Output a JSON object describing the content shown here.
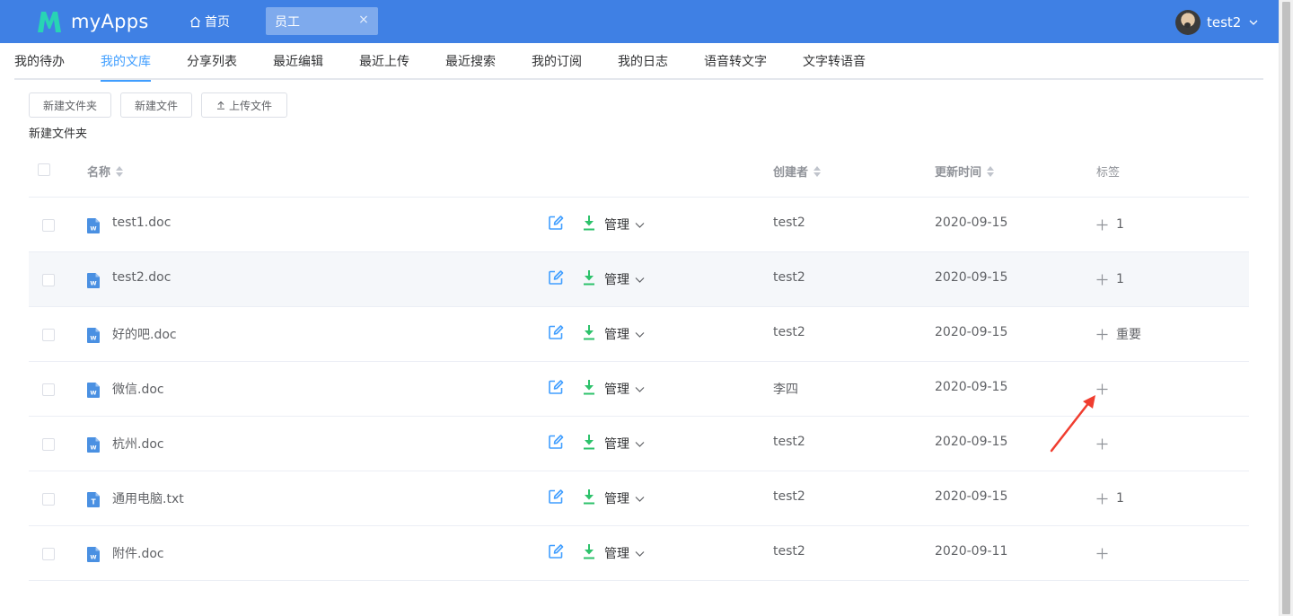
{
  "header": {
    "brand": "myApps",
    "home_tab": "首页",
    "active_tab": "员工",
    "close_glyph": "×",
    "user": "test2",
    "bg_color": "#3f80e4"
  },
  "subnav": {
    "items": [
      "我的待办",
      "我的文库",
      "分享列表",
      "最近编辑",
      "最近上传",
      "最近搜索",
      "我的订阅",
      "我的日志",
      "语音转文字",
      "文字转语音"
    ],
    "active_index": 1
  },
  "toolbar": {
    "new_folder": "新建文件夹",
    "new_file": "新建文件",
    "upload": "上传文件",
    "hint": "新建文件夹"
  },
  "table": {
    "headers": {
      "name": "名称",
      "creator": "创建者",
      "updated": "更新时间",
      "tags": "标签"
    },
    "manage_label": "管理",
    "rows": [
      {
        "name": "test1.doc",
        "type": "doc",
        "creator": "test2",
        "date": "2020-09-15",
        "tag": "1"
      },
      {
        "name": "test2.doc",
        "type": "doc",
        "creator": "test2",
        "date": "2020-09-15",
        "tag": "1"
      },
      {
        "name": "好的吧.doc",
        "type": "doc",
        "creator": "test2",
        "date": "2020-09-15",
        "tag": "重要"
      },
      {
        "name": "微信.doc",
        "type": "doc",
        "creator": "李四",
        "date": "2020-09-15",
        "tag": ""
      },
      {
        "name": "杭州.doc",
        "type": "doc",
        "creator": "test2",
        "date": "2020-09-15",
        "tag": ""
      },
      {
        "name": "通用电脑.txt",
        "type": "txt",
        "creator": "test2",
        "date": "2020-09-15",
        "tag": "1"
      },
      {
        "name": "附件.doc",
        "type": "doc",
        "creator": "test2",
        "date": "2020-09-11",
        "tag": ""
      }
    ],
    "hover_row": 1
  },
  "colors": {
    "accent": "#409eff",
    "download": "#2dc26b",
    "annotation": "#f03d2f",
    "file_icon": "#4a90e2"
  }
}
